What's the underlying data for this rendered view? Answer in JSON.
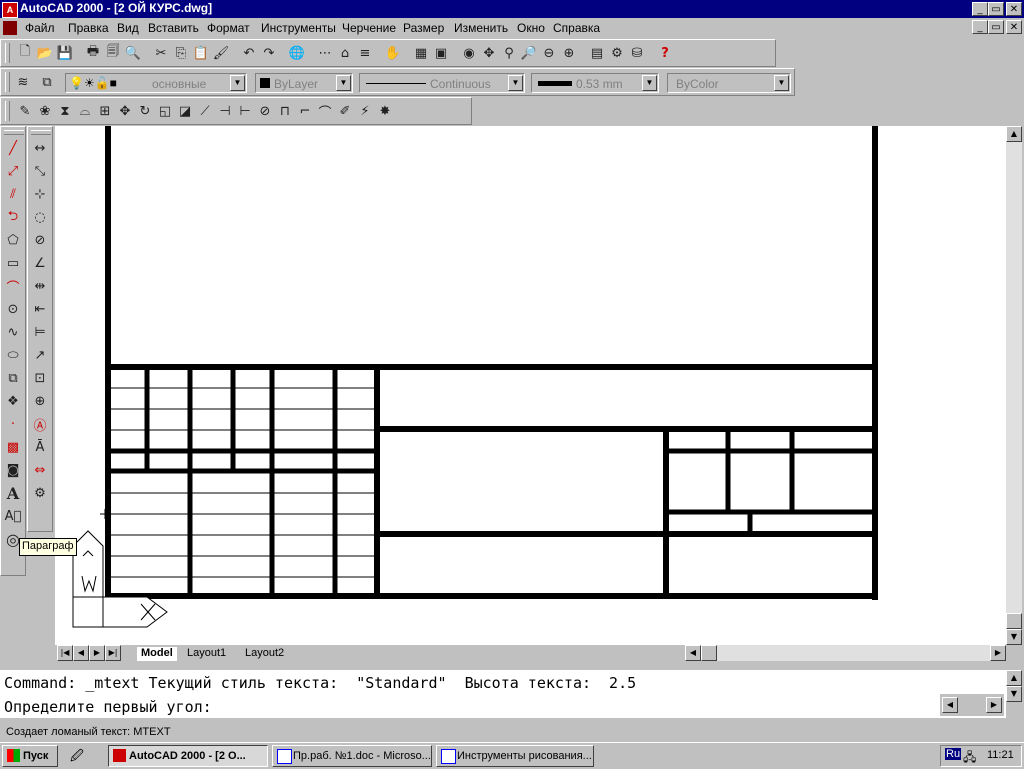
{
  "window": {
    "title": "AutoCAD 2000 - [2 ОЙ КУРС.dwg]",
    "icon": "autocad-app-icon",
    "controls": {
      "minimize": "_",
      "restore": "▭",
      "close": "✕"
    }
  },
  "menu": {
    "items": [
      "Файл",
      "Правка",
      "Вид",
      "Вставить",
      "Формат",
      "Инструменты",
      "Черчение",
      "Размер",
      "Изменить",
      "Окно",
      "Справка"
    ]
  },
  "properties_bar": {
    "layer": "основные",
    "color": "ByLayer",
    "linetype": "Continuous",
    "lineweight": "0.53 mm",
    "plotstyle": "ByColor"
  },
  "tooltip": {
    "text": "Параграф"
  },
  "tabs": [
    "Model",
    "Layout1",
    "Layout2"
  ],
  "command": {
    "line1": "Command: _mtext Текущий стиль текста:  \"Standard\"  Высота текста:  2.5",
    "line2": "Определите первый угол:"
  },
  "status": {
    "text": "Создает ломаный текст:  MTEXT"
  },
  "taskbar": {
    "start": "Пуск",
    "tasks": [
      "AutoCAD 2000 - [2 О...",
      "Пр.раб. №1.doc - Microso...",
      "Инструменты рисования..."
    ],
    "lang": "Ru",
    "clock": "11:21"
  },
  "colors": {
    "titlebar": "#000080",
    "face": "#c0c0c0",
    "canvas": "#ffffff",
    "lines": "#000000"
  }
}
